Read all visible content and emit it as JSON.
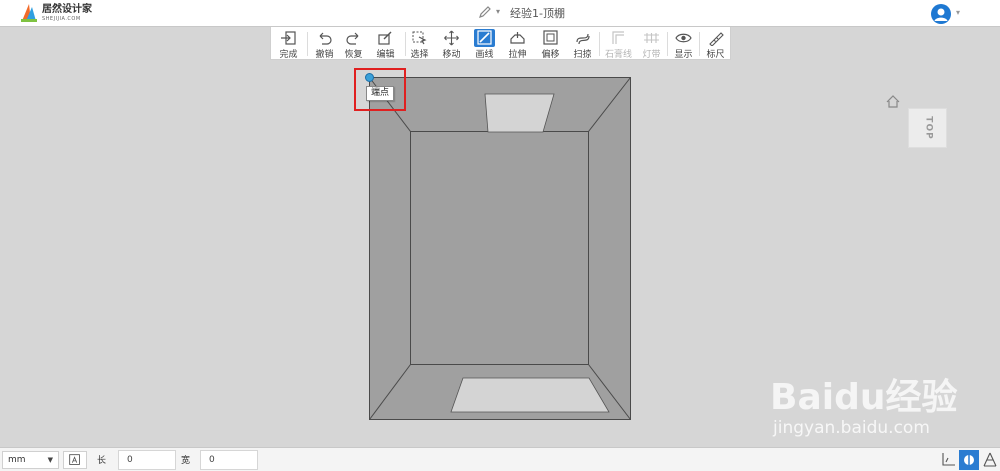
{
  "header": {
    "brand_name": "居然设计家",
    "brand_sub": "SHEJIJIA.COM",
    "doc_title": "经验1-顶棚"
  },
  "toolbar": {
    "items": [
      {
        "label": "完成",
        "icon": "finish-icon"
      },
      {
        "label": "撤销",
        "icon": "undo-icon"
      },
      {
        "label": "恢复",
        "icon": "redo-icon"
      },
      {
        "label": "编辑",
        "icon": "edit-icon"
      },
      {
        "label": "选择",
        "icon": "select-icon"
      },
      {
        "label": "移动",
        "icon": "move-icon"
      },
      {
        "label": "画线",
        "icon": "draw-line-icon",
        "active": true
      },
      {
        "label": "拉伸",
        "icon": "extrude-icon"
      },
      {
        "label": "偏移",
        "icon": "offset-icon"
      },
      {
        "label": "扫掠",
        "icon": "sweep-icon"
      },
      {
        "label": "石膏线",
        "icon": "molding-icon",
        "disabled": true
      },
      {
        "label": "灯带",
        "icon": "light-strip-icon",
        "disabled": true
      },
      {
        "label": "显示",
        "icon": "display-icon"
      },
      {
        "label": "标尺",
        "icon": "ruler-icon"
      }
    ]
  },
  "canvas": {
    "tooltip": "端点",
    "view_cube_label": "TOP",
    "colors": {
      "room_fill": "#a0a0a0",
      "opening_fill": "#d4d4d4",
      "highlight": "#e02020",
      "vertex": "#3aa0d8"
    }
  },
  "watermark": {
    "text": "Bai🐾du经验",
    "main": "Baidu经验",
    "url": "jingyan.baidu.com"
  },
  "statusbar": {
    "unit": "mm",
    "length_label": "长",
    "length_value": "0",
    "width_label": "宽",
    "width_value": "0"
  },
  "accent_color": "#2a7cd1"
}
